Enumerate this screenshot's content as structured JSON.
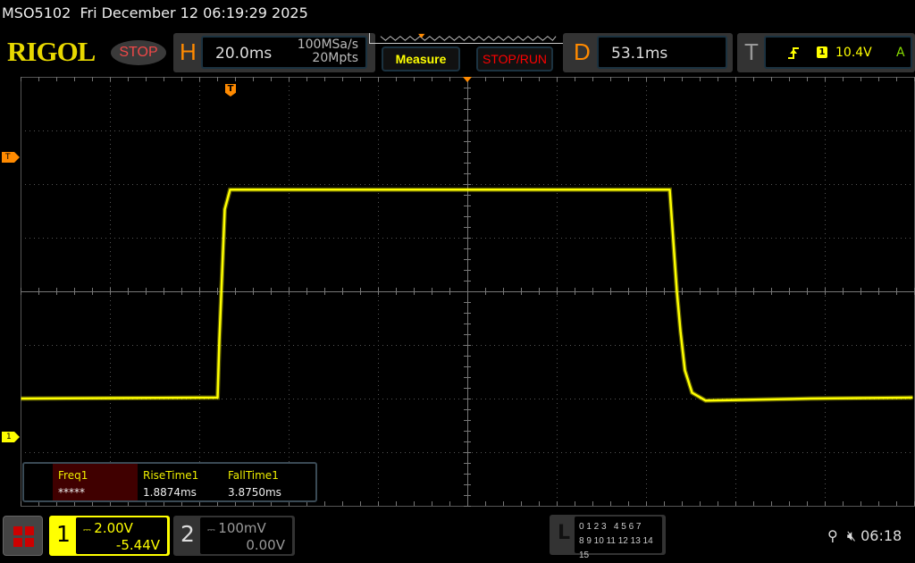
{
  "title_bar": {
    "model": "MSO5102",
    "datetime": "Fri December 12 06:19:29 2025"
  },
  "logo": "RIGOL",
  "run_state": "STOP",
  "horizontal": {
    "letter": "H",
    "timebase": "20.0ms",
    "sample_rate": "100MSa/s",
    "memory_depth": "20Mpts"
  },
  "buttons": {
    "measure": "Measure",
    "stop_run": "STOP/RUN"
  },
  "delay": {
    "letter": "D",
    "value": "53.1ms"
  },
  "trigger": {
    "letter": "T",
    "slope_icon": "rising-edge-icon",
    "source": "1",
    "level": "10.4V",
    "mode": "A"
  },
  "markers": {
    "trigger_time": "T",
    "trigger_level": "T",
    "ch1_ground": "1"
  },
  "measurements": [
    {
      "name": "Freq1",
      "value": "*****",
      "highlighted": true
    },
    {
      "name": "RiseTime1",
      "value": "1.8874ms"
    },
    {
      "name": "FallTime1",
      "value": "3.8750ms"
    }
  ],
  "channels": [
    {
      "num": "1",
      "coupling_icon": "dc-coupling-icon",
      "scale": "2.00V",
      "offset": "-5.44V",
      "active": true,
      "color": "#ffff00"
    },
    {
      "num": "2",
      "coupling_icon": "dc-coupling-icon",
      "scale": "100mV",
      "offset": "0.00V",
      "active": false,
      "color": "#aaaaaa"
    }
  ],
  "logic": {
    "letter": "L",
    "row1": "0 1 2 3   4 5 6 7",
    "row2": "8 9 10 11 12 13 14 15"
  },
  "status": {
    "usb_icon": "usb-icon",
    "mute_icon": "speaker-muted-icon",
    "time": "06:18"
  },
  "chart_data": {
    "type": "line",
    "xlabel": "",
    "ylabel": "",
    "xlim": [
      -46.9,
      153.1
    ],
    "ylim": [
      -5.44,
      16.32
    ],
    "grid": true,
    "series": [
      {
        "color": "#ffff00",
        "x": [
          -46.8,
          -2.8,
          -2.4,
          -1.2,
          0,
          50,
          98.4,
          100,
          100.8,
          101.8,
          103.4,
          106.4,
          130,
          152.8
        ],
        "y": [
          0.0,
          0.05,
          2.97,
          9.6,
          10.6,
          10.6,
          10.6,
          5.43,
          3.43,
          1.43,
          0.3,
          -0.1,
          0.0,
          0.05
        ]
      }
    ]
  }
}
